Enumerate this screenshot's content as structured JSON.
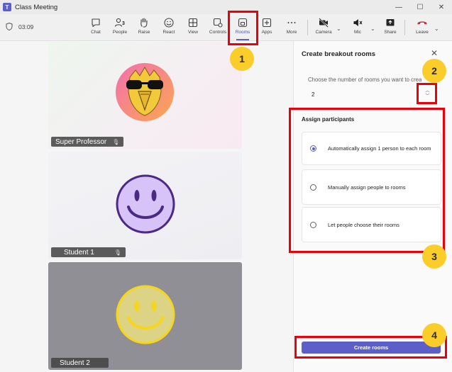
{
  "window": {
    "title": "Class Meeting",
    "controls": [
      "—",
      "☐",
      "✕"
    ]
  },
  "toolbar": {
    "timer": "03:09",
    "items": [
      {
        "label": "Chat",
        "icon": "chat-icon"
      },
      {
        "label": "People",
        "icon": "people-icon",
        "badge": "3"
      },
      {
        "label": "Raise",
        "icon": "raise-hand-icon"
      },
      {
        "label": "React",
        "icon": "react-icon"
      },
      {
        "label": "View",
        "icon": "view-icon"
      },
      {
        "label": "Controls",
        "icon": "controls-icon"
      },
      {
        "label": "Rooms",
        "icon": "rooms-icon",
        "active": true
      },
      {
        "label": "Apps",
        "icon": "apps-icon"
      },
      {
        "label": "More",
        "icon": "more-icon"
      },
      {
        "label": "Camera",
        "icon": "camera-off-icon"
      },
      {
        "label": "Mic",
        "icon": "mic-off-icon"
      },
      {
        "label": "Share",
        "icon": "share-icon"
      },
      {
        "label": "Leave",
        "icon": "leave-icon"
      }
    ]
  },
  "participants": [
    {
      "name": "Super Professor",
      "muted": true
    },
    {
      "name": "Student 1",
      "muted": true
    },
    {
      "name": "Student 2",
      "muted": false
    }
  ],
  "panel": {
    "title": "Create breakout rooms",
    "rooms_prompt": "Choose the number of rooms you want to create",
    "rooms_value": "2",
    "assign_title": "Assign participants",
    "options": [
      {
        "label": "Automatically assign 1 person to each room",
        "selected": true
      },
      {
        "label": "Manually assign people to rooms",
        "selected": false
      },
      {
        "label": "Let people choose their rooms",
        "selected": false
      }
    ],
    "create_button": "Create rooms"
  },
  "annotations": [
    "1",
    "2",
    "3",
    "4"
  ],
  "colors": {
    "accent": "#5b5fc7",
    "highlight": "#e8000b",
    "badge": "#fbcd2a",
    "leave": "#c4314b"
  }
}
